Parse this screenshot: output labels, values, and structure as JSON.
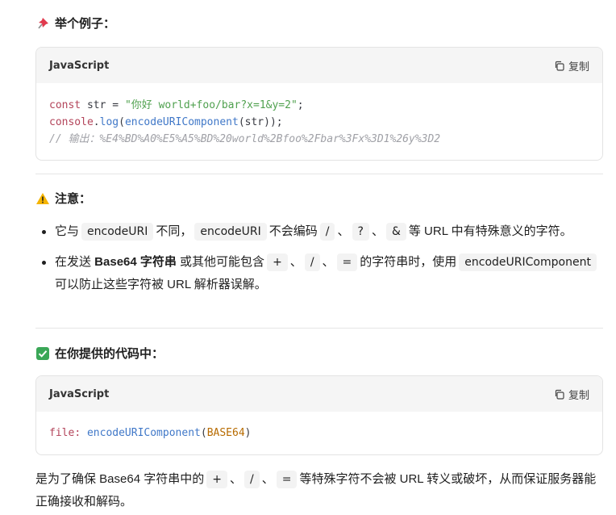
{
  "section1": {
    "icon": "pushpin-icon",
    "title": "举个例子："
  },
  "code1": {
    "lang": "JavaScript",
    "copy_label": "复制",
    "line1": {
      "kw": "const",
      "name": " str = ",
      "str": "\"你好 world+foo/bar?x=1&y=2\"",
      "end": ";"
    },
    "line2": {
      "obj": "console",
      "dot": ".",
      "fn": "log",
      "open": "(",
      "fn2": "encodeURIComponent",
      "rest": "(str));"
    },
    "line3": "// 输出：%E4%BD%A0%E5%A5%BD%20world%2Bfoo%2Fbar%3Fx%3D1%26y%3D2"
  },
  "section2": {
    "icon": "warning-icon",
    "title": "注意："
  },
  "notes": {
    "item1": {
      "t1": "它与",
      "c1": "encodeURI",
      "t2": "不同，",
      "c2": "encodeURI",
      "t3": "不会编码",
      "c3": "/",
      "s1": "、",
      "c4": "?",
      "s2": "、",
      "c5": "&",
      "t4": "等 URL 中有特殊意义的字符。"
    },
    "item2": {
      "t1": "在发送 ",
      "b1": "Base64 字符串",
      "t2": " 或其他可能包含",
      "c1": "+",
      "s1": "、",
      "c2": "/",
      "s2": "、",
      "c3": "=",
      "t3": "的字符串时，使用",
      "c4": "encodeURIComponent",
      "t4": "可以防止这些字符被 URL 解析器误解。"
    }
  },
  "section3": {
    "icon": "check-box-icon",
    "title": "在你提供的代码中："
  },
  "code2": {
    "lang": "JavaScript",
    "copy_label": "复制",
    "key": "file",
    "colon": ": ",
    "fn": "encodeURIComponent",
    "open": "(",
    "arg": "BASE64",
    "close": ")"
  },
  "closing": {
    "t1": "是为了确保 Base64 字符串中的",
    "c1": "+",
    "s1": "、",
    "c2": "/",
    "s2": "、",
    "c3": "=",
    "t2": "等特殊字符不会被 URL 转义或破坏，从而保证服务器能正确接收和解码。"
  }
}
